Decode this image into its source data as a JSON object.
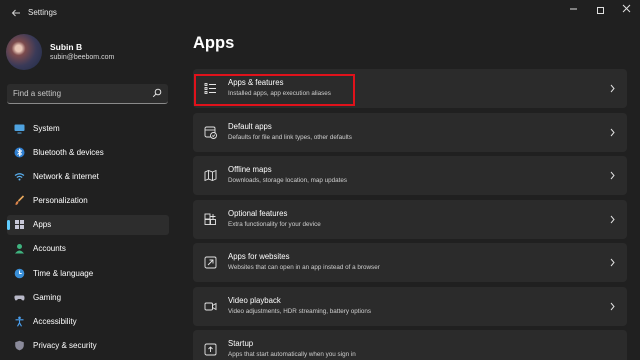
{
  "window": {
    "title": "Settings",
    "icons": {
      "back": "back-arrow-icon",
      "minimize": "minimize-icon",
      "maximize": "maximize-icon",
      "close": "close-icon"
    }
  },
  "profile": {
    "name": "Subin B",
    "email": "subin@beebom.com"
  },
  "search": {
    "placeholder": "Find a setting",
    "icon": "search-icon"
  },
  "sidebar": {
    "accent": "#60cdff",
    "items": [
      {
        "label": "System",
        "icon": "monitor-icon",
        "active": false
      },
      {
        "label": "Bluetooth & devices",
        "icon": "bluetooth-icon",
        "active": false
      },
      {
        "label": "Network & internet",
        "icon": "wifi-icon",
        "active": false
      },
      {
        "label": "Personalization",
        "icon": "brush-icon",
        "active": false
      },
      {
        "label": "Apps",
        "icon": "apps-icon",
        "active": true
      },
      {
        "label": "Accounts",
        "icon": "person-icon",
        "active": false
      },
      {
        "label": "Time & language",
        "icon": "globe-clock-icon",
        "active": false
      },
      {
        "label": "Gaming",
        "icon": "controller-icon",
        "active": false
      },
      {
        "label": "Accessibility",
        "icon": "accessibility-icon",
        "active": false
      },
      {
        "label": "Privacy & security",
        "icon": "shield-icon",
        "active": false
      }
    ]
  },
  "main": {
    "title": "Apps",
    "highlight_color": "#e0121b",
    "cards": [
      {
        "title": "Apps & features",
        "subtitle": "Installed apps, app execution aliases",
        "icon": "list-icon",
        "highlighted": true
      },
      {
        "title": "Default apps",
        "subtitle": "Defaults for file and link types, other defaults",
        "icon": "default-apps-icon",
        "highlighted": false
      },
      {
        "title": "Offline maps",
        "subtitle": "Downloads, storage location, map updates",
        "icon": "map-icon",
        "highlighted": false
      },
      {
        "title": "Optional features",
        "subtitle": "Extra functionality for your device",
        "icon": "add-grid-icon",
        "highlighted": false
      },
      {
        "title": "Apps for websites",
        "subtitle": "Websites that can open in an app instead of a browser",
        "icon": "open-link-icon",
        "highlighted": false
      },
      {
        "title": "Video playback",
        "subtitle": "Video adjustments, HDR streaming, battery options",
        "icon": "video-icon",
        "highlighted": false
      },
      {
        "title": "Startup",
        "subtitle": "Apps that start automatically when you sign in",
        "icon": "startup-icon",
        "highlighted": false
      }
    ]
  }
}
